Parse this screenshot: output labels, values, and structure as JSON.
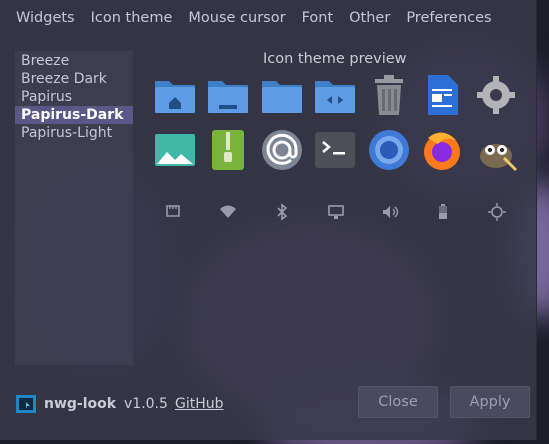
{
  "tabs": [
    "Widgets",
    "Icon theme",
    "Mouse cursor",
    "Font",
    "Other",
    "Preferences"
  ],
  "themes": [
    {
      "label": "Breeze"
    },
    {
      "label": "Breeze Dark"
    },
    {
      "label": "Papirus"
    },
    {
      "label": "Papirus-Dark",
      "selected": true
    },
    {
      "label": "Papirus-Light"
    }
  ],
  "preview": {
    "title": "Icon theme preview"
  },
  "footer": {
    "app_name": "nwg-look",
    "version": "v1.0.5",
    "github_label": "GitHub",
    "close_label": "Close",
    "apply_label": "Apply"
  },
  "colors": {
    "selected": "#5b5786",
    "folder": "#5e9de6",
    "accent": "#5294e2"
  }
}
